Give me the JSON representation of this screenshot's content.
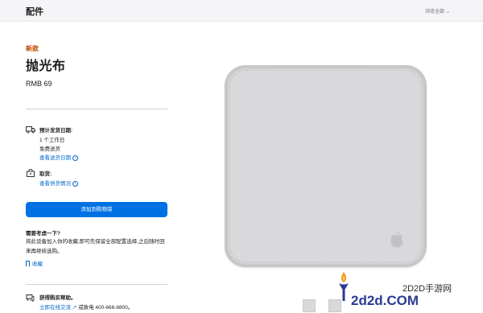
{
  "topbar": {
    "title": "配件",
    "browse_label": "浏览全部",
    "browse_chevron": "⌄"
  },
  "product": {
    "new_tag": "新款",
    "name": "抛光布",
    "price": "RMB 69"
  },
  "delivery": {
    "icon": "truck-icon",
    "heading": "预计发货日期:",
    "line1": "1 个工作日",
    "line2": "免费送货",
    "link": "查看送货日期",
    "link_icon": "chevron-right-circle-icon"
  },
  "pickup": {
    "icon": "store-icon",
    "heading": "取货:",
    "link": "查看供货情况",
    "link_icon": "chevron-right-circle-icon"
  },
  "cart_button": "添加到购物袋",
  "consider": {
    "heading": "需要考虑一下?",
    "text": "将此设备加入你的收藏,即可先保留全部配置选择,之后随时回来再继续选购。",
    "save_link": "收藏",
    "save_icon": "bookmark-icon"
  },
  "help": {
    "icon": "chat-bubble-icon",
    "heading": "获得购买帮助。",
    "chat_link": "立即在线交流",
    "chat_arrow": "↗",
    "phone_text": "或致电 400-666-8800。"
  },
  "image": {
    "alt_icon": "apple-logo-icon"
  },
  "watermark": {
    "site_name": "2D2D手游网",
    "domain": "2d2d.COM"
  },
  "colors": {
    "accent": "#0071e3",
    "link": "#0066cc",
    "new_tag": "#bf4800",
    "topbar": "#f5f5f7"
  }
}
